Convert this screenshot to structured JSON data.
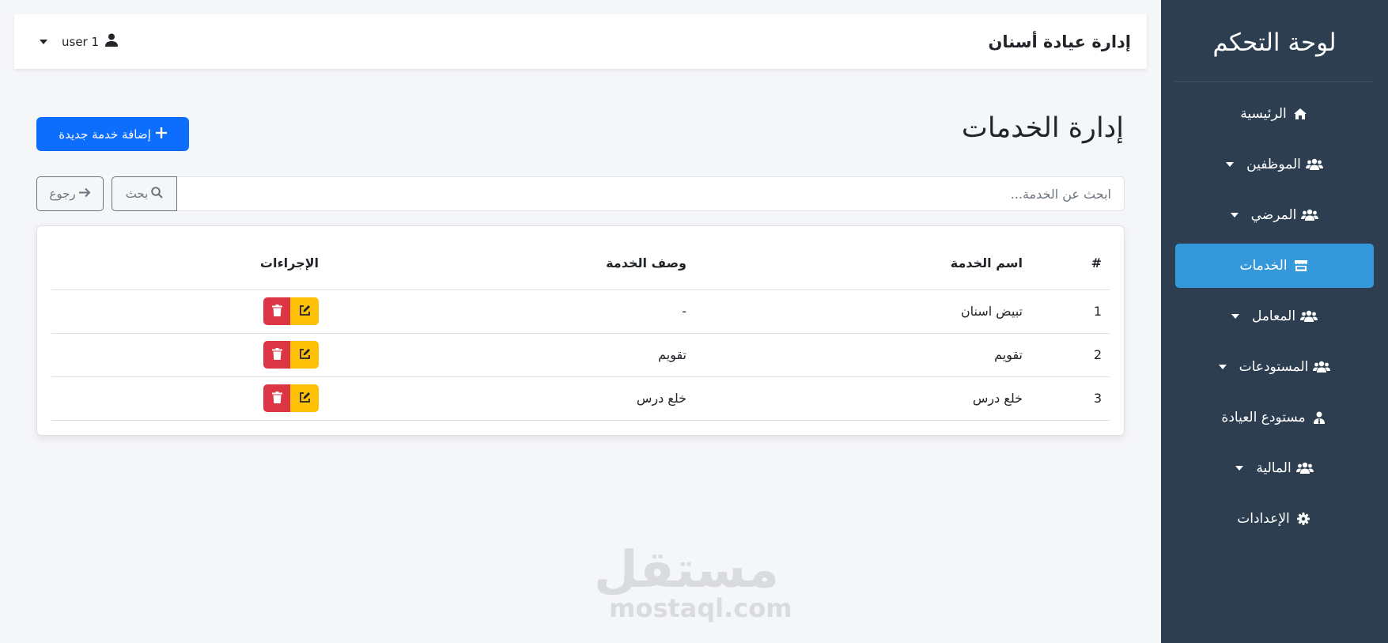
{
  "sidebar": {
    "title": "لوحة التحكم",
    "items": [
      {
        "label": "الرئيسية",
        "icon": "home-icon",
        "dropdown": false,
        "active": false
      },
      {
        "label": "الموظفين",
        "icon": "users-icon",
        "dropdown": true,
        "active": false
      },
      {
        "label": "المرضي",
        "icon": "users-icon",
        "dropdown": true,
        "active": false
      },
      {
        "label": "الخدمات",
        "icon": "store-icon",
        "dropdown": false,
        "active": true
      },
      {
        "label": "المعامل",
        "icon": "users-icon",
        "dropdown": true,
        "active": false
      },
      {
        "label": "المستودعات",
        "icon": "users-icon",
        "dropdown": true,
        "active": false
      },
      {
        "label": "مستودع العيادة",
        "icon": "user-tie-icon",
        "dropdown": false,
        "active": false
      },
      {
        "label": "المالية",
        "icon": "users-icon",
        "dropdown": true,
        "active": false
      },
      {
        "label": "الإعدادات",
        "icon": "gear-icon",
        "dropdown": false,
        "active": false
      }
    ]
  },
  "header": {
    "title": "إدارة عيادة أسنان",
    "user": "user 1"
  },
  "main": {
    "page_title": "إدارة الخدمات",
    "add_button": "إضافة خدمة جديدة",
    "search_placeholder": "ابحث عن الخدمة...",
    "search_button": "بحث",
    "back_button": "رجوع",
    "table": {
      "headers": [
        "#",
        "اسم الخدمة",
        "وصف الخدمة",
        "الإجراءات"
      ],
      "rows": [
        {
          "num": "1",
          "name": "تبيض اسنان",
          "desc": "-"
        },
        {
          "num": "2",
          "name": "تقويم",
          "desc": "تقويم"
        },
        {
          "num": "3",
          "name": "خلع درس",
          "desc": "خلع درس"
        }
      ]
    }
  },
  "watermark": {
    "arabic": "مستقل",
    "latin": "mostaql.com"
  },
  "colors": {
    "sidebar_bg": "#2c3e50",
    "active_item": "#3498db",
    "primary": "#0d6efd",
    "danger": "#dc3545",
    "warning": "#ffc107",
    "page_bg": "#f5f6f8"
  }
}
